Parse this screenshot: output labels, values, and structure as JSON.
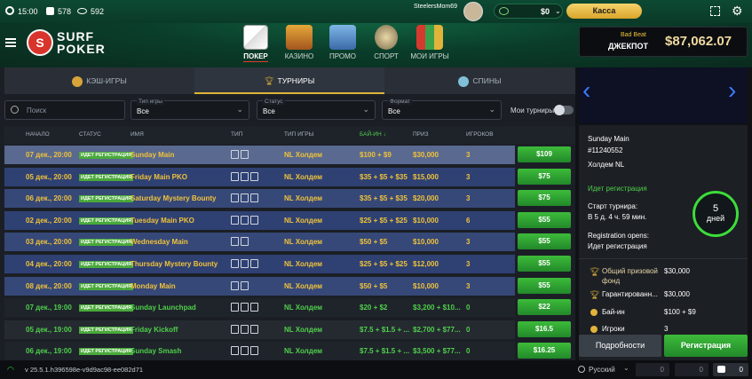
{
  "topbar": {
    "time": "15:00",
    "count1": "578",
    "count2": "592",
    "username": "SteelersMom69",
    "balance": "$0",
    "cashier_label": "Касса"
  },
  "nav": [
    {
      "label": "ПОКЕР"
    },
    {
      "label": "КАЗИНО"
    },
    {
      "label": "ПРОМО"
    },
    {
      "label": "СПОРТ"
    },
    {
      "label": "МОИ ИГРЫ"
    }
  ],
  "logo": {
    "text_top": "SURF",
    "text_bottom": "POKER",
    "letter": "S"
  },
  "jackpot": {
    "subtitle": "Bad Beat",
    "title": "ДЖЕКПОТ",
    "amount": "$87,062.07"
  },
  "tabs": [
    {
      "label": "КЭШ-ИГРЫ"
    },
    {
      "label": "ТУРНИРЫ"
    },
    {
      "label": "СПИНЫ"
    }
  ],
  "filters": {
    "search_placeholder": "Поиск",
    "game_type_label": "Тип игры",
    "game_type_value": "Все",
    "status_label": "Статус",
    "status_value": "Все",
    "format_label": "Формат",
    "format_value": "Все",
    "my_tournaments_label": "Мои турниры"
  },
  "table": {
    "headers": [
      "НАЧАЛО",
      "СТАТУС",
      "ИМЯ",
      "ТИП",
      "ТИП ИГРЫ",
      "БАЙ-ИН ↓",
      "ПРИЗ",
      "ИГРОКОВ"
    ],
    "rows": [
      {
        "start": "07 дек., 20:00",
        "status": "ИДЕТ РЕГИСТРАЦИЯ",
        "name": "Sunday Main",
        "game": "NL Холдем",
        "buyin": "$100 + $9",
        "prize": "$30,000",
        "players": "3",
        "button": "$109"
      },
      {
        "start": "05 дек., 20:00",
        "status": "ИДЕТ РЕГИСТРАЦИЯ",
        "name": "Friday Main PKO",
        "game": "NL Холдем",
        "buyin": "$35 + $5 + $35",
        "prize": "$15,000",
        "players": "3",
        "button": "$75"
      },
      {
        "start": "06 дек., 20:00",
        "status": "ИДЕТ РЕГИСТРАЦИЯ",
        "name": "Saturday Mystery Bounty",
        "game": "NL Холдем",
        "buyin": "$35 + $5 + $35",
        "prize": "$20,000",
        "players": "3",
        "button": "$75"
      },
      {
        "start": "02 дек., 20:00",
        "status": "ИДЕТ РЕГИСТРАЦИЯ",
        "name": "Tuesday Main PKO",
        "game": "NL Холдем",
        "buyin": "$25 + $5 + $25",
        "prize": "$10,000",
        "players": "6",
        "button": "$55"
      },
      {
        "start": "03 дек., 20:00",
        "status": "ИДЕТ РЕГИСТРАЦИЯ",
        "name": "Wednesday Main",
        "game": "NL Холдем",
        "buyin": "$50 + $5",
        "prize": "$10,000",
        "players": "3",
        "button": "$55"
      },
      {
        "start": "04 дек., 20:00",
        "status": "ИДЕТ РЕГИСТРАЦИЯ",
        "name": "Thursday Mystery Bounty",
        "game": "NL Холдем",
        "buyin": "$25 + $5 + $25",
        "prize": "$12,000",
        "players": "3",
        "button": "$55"
      },
      {
        "start": "08 дек., 20:00",
        "status": "ИДЕТ РЕГИСТРАЦИЯ",
        "name": "Monday Main",
        "game": "NL Холдем",
        "buyin": "$50 + $5",
        "prize": "$10,000",
        "players": "3",
        "button": "$55"
      },
      {
        "start": "07 дек., 19:00",
        "status": "ИДЕТ РЕГИСТРАЦИЯ",
        "name": "Sunday Launchpad",
        "game": "NL Холдем",
        "buyin": "$20 + $2",
        "prize": "$3,200 + $10...",
        "players": "0",
        "button": "$22"
      },
      {
        "start": "05 дек., 19:00",
        "status": "ИДЕТ РЕГИСТРАЦИЯ",
        "name": "Friday Kickoff",
        "game": "NL Холдем",
        "buyin": "$7.5 + $1.5 + ...",
        "prize": "$2,700 + $77...",
        "players": "0",
        "button": "$16.5"
      },
      {
        "start": "06 дек., 19:00",
        "status": "ИДЕТ РЕГИСТРАЦИЯ",
        "name": "Sunday Smash",
        "game": "NL Холдем",
        "buyin": "$7.5 + $1.5 + ...",
        "prize": "$3,500 + $77...",
        "players": "0",
        "button": "$16.25"
      }
    ]
  },
  "details": {
    "name": "Sunday Main",
    "id": "#11240552",
    "game": "Холдем NL",
    "status": "Идет регистрация",
    "start_label": "Старт турнира:",
    "start_value": "В 5 д. 4 ч. 59 мин.",
    "reg_label": "Registration opens:",
    "reg_value": "Идет регистрация",
    "countdown_num": "5",
    "countdown_unit": "дней",
    "prize_label": "Общий призовой фонд",
    "prize_value": "$30,000",
    "guaranteed_label": "Гарантированн...",
    "guaranteed_value": "$30,000",
    "buyin_label": "Бай-ин",
    "buyin_value": "$100 + $9",
    "players_label": "Игроки",
    "players_value": "3",
    "details_button": "Подробности",
    "register_button": "Регистрация"
  },
  "footer": {
    "version": "v 25.5.1.h396598e-v9d9ac98-ee082d71",
    "language": "Русский",
    "c1": "0",
    "c2": "0",
    "c3": "0"
  },
  "colors": {
    "accent_green": "#3dbb3a",
    "gold": "#f0c23a",
    "row_blue": "#34457a",
    "row_dark": "#2a2f38"
  }
}
